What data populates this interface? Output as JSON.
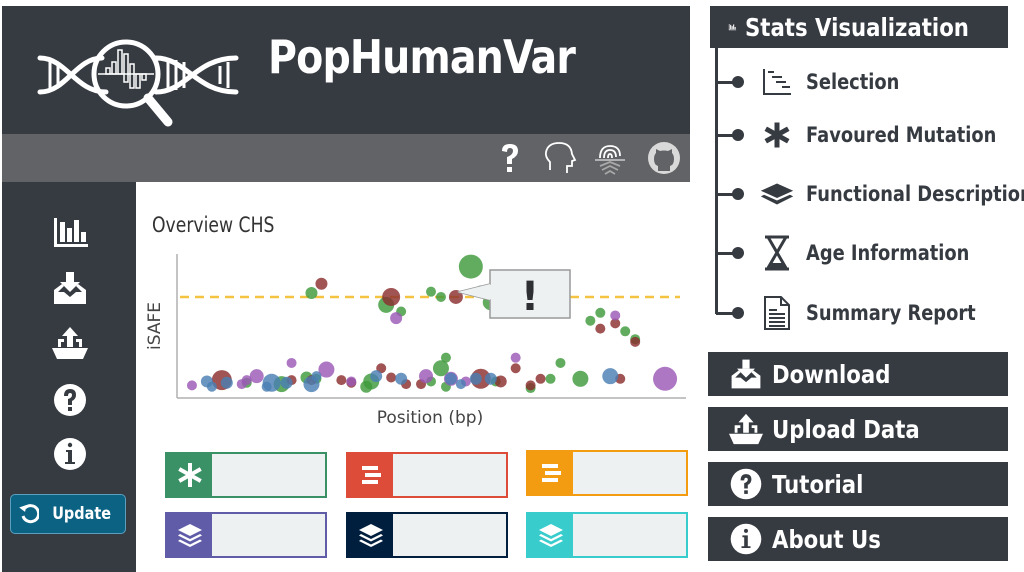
{
  "app": {
    "title": "PopHumanVar",
    "logo": "dna-magnifier-logo",
    "toolbar_icons": [
      "question-icon",
      "head-profile-icon",
      "fingerprint-icon",
      "github-icon"
    ],
    "sidebar_icons": [
      "bar-chart-icon",
      "download-inbox-icon",
      "upload-tray-icon",
      "question-circle-icon",
      "info-circle-icon"
    ],
    "update_button": "Update"
  },
  "chart_data": {
    "type": "scatter",
    "title": "Overview CHS",
    "xlabel": "Position (bp)",
    "ylabel": "iSAFE",
    "threshold_line": {
      "y": 0.72,
      "style": "dashed",
      "color": "#f5c342"
    },
    "xlim": [
      0,
      1
    ],
    "ylim": [
      0,
      1
    ],
    "grid": false,
    "annotation": {
      "text": "!",
      "target": "highlighted-point"
    },
    "series": [
      {
        "name": "green",
        "color": "#3f9a3c",
        "points": [
          {
            "x": 0.13,
            "y": 0.07,
            "r": 5
          },
          {
            "x": 0.25,
            "y": 0.11,
            "r": 6
          },
          {
            "x": 0.26,
            "y": 0.75,
            "r": 6
          },
          {
            "x": 0.2,
            "y": 0.06,
            "r": 8
          },
          {
            "x": 0.37,
            "y": 0.04,
            "r": 6
          },
          {
            "x": 0.38,
            "y": 0.08,
            "r": 8
          },
          {
            "x": 0.41,
            "y": 0.66,
            "r": 8
          },
          {
            "x": 0.44,
            "y": 0.61,
            "r": 5
          },
          {
            "x": 0.5,
            "y": 0.76,
            "r": 5
          },
          {
            "x": 0.52,
            "y": 0.72,
            "r": 5
          },
          {
            "x": 0.58,
            "y": 0.95,
            "r": 12
          },
          {
            "x": 0.6,
            "y": 0.77,
            "r": 5
          },
          {
            "x": 0.62,
            "y": 0.68,
            "r": 8
          },
          {
            "x": 0.53,
            "y": 0.26,
            "r": 5
          },
          {
            "x": 0.52,
            "y": 0.18,
            "r": 8
          },
          {
            "x": 0.5,
            "y": 0.08,
            "r": 5
          },
          {
            "x": 0.53,
            "y": 0.04,
            "r": 5
          },
          {
            "x": 0.63,
            "y": 0.08,
            "r": 5
          },
          {
            "x": 0.76,
            "y": 0.22,
            "r": 5
          },
          {
            "x": 0.74,
            "y": 0.1,
            "r": 5
          },
          {
            "x": 0.7,
            "y": 0.03,
            "r": 5
          },
          {
            "x": 0.8,
            "y": 0.1,
            "r": 8
          },
          {
            "x": 0.82,
            "y": 0.54,
            "r": 5
          },
          {
            "x": 0.84,
            "y": 0.6,
            "r": 5
          },
          {
            "x": 0.89,
            "y": 0.46,
            "r": 5
          },
          {
            "x": 0.91,
            "y": 0.4,
            "r": 5
          },
          {
            "x": 0.27,
            "y": 0.1,
            "r": 5
          }
        ]
      },
      {
        "name": "maroon",
        "color": "#8b2e2e",
        "points": [
          {
            "x": 0.08,
            "y": 0.09,
            "r": 10
          },
          {
            "x": 0.28,
            "y": 0.82,
            "r": 6
          },
          {
            "x": 0.22,
            "y": 0.09,
            "r": 5
          },
          {
            "x": 0.26,
            "y": 0.09,
            "r": 5
          },
          {
            "x": 0.34,
            "y": 0.07,
            "r": 5
          },
          {
            "x": 0.32,
            "y": 0.09,
            "r": 5
          },
          {
            "x": 0.4,
            "y": 0.18,
            "r": 5
          },
          {
            "x": 0.42,
            "y": 0.11,
            "r": 5
          },
          {
            "x": 0.42,
            "y": 0.72,
            "r": 9
          },
          {
            "x": 0.55,
            "y": 0.72,
            "r": 7
          },
          {
            "x": 0.45,
            "y": 0.06,
            "r": 5
          },
          {
            "x": 0.48,
            "y": 0.06,
            "r": 5
          },
          {
            "x": 0.6,
            "y": 0.1,
            "r": 10
          },
          {
            "x": 0.64,
            "y": 0.08,
            "r": 6
          },
          {
            "x": 0.67,
            "y": 0.18,
            "r": 5
          },
          {
            "x": 0.7,
            "y": 0.05,
            "r": 5
          },
          {
            "x": 0.84,
            "y": 0.48,
            "r": 5
          },
          {
            "x": 0.87,
            "y": 0.52,
            "r": 5
          },
          {
            "x": 0.91,
            "y": 0.38,
            "r": 5
          },
          {
            "x": 0.88,
            "y": 0.1,
            "r": 5
          },
          {
            "x": 0.72,
            "y": 0.1,
            "r": 5
          }
        ]
      },
      {
        "name": "purple",
        "color": "#9b59b6",
        "points": [
          {
            "x": 0.02,
            "y": 0.05,
            "r": 5
          },
          {
            "x": 0.15,
            "y": 0.12,
            "r": 7
          },
          {
            "x": 0.22,
            "y": 0.22,
            "r": 5
          },
          {
            "x": 0.29,
            "y": 0.17,
            "r": 8
          },
          {
            "x": 0.43,
            "y": 0.56,
            "r": 6
          },
          {
            "x": 0.34,
            "y": 0.08,
            "r": 5
          },
          {
            "x": 0.49,
            "y": 0.12,
            "r": 7
          },
          {
            "x": 0.54,
            "y": 0.1,
            "r": 7
          },
          {
            "x": 0.57,
            "y": 0.08,
            "r": 5
          },
          {
            "x": 0.67,
            "y": 0.26,
            "r": 5
          },
          {
            "x": 0.87,
            "y": 0.58,
            "r": 5
          },
          {
            "x": 0.97,
            "y": 0.1,
            "r": 12
          },
          {
            "x": 0.13,
            "y": 0.09,
            "r": 5
          },
          {
            "x": 0.12,
            "y": 0.06,
            "r": 5
          }
        ]
      },
      {
        "name": "blue",
        "color": "#4b7fb3",
        "points": [
          {
            "x": 0.05,
            "y": 0.08,
            "r": 6
          },
          {
            "x": 0.06,
            "y": 0.04,
            "r": 5
          },
          {
            "x": 0.09,
            "y": 0.07,
            "r": 6
          },
          {
            "x": 0.18,
            "y": 0.07,
            "r": 9
          },
          {
            "x": 0.21,
            "y": 0.07,
            "r": 6
          },
          {
            "x": 0.26,
            "y": 0.06,
            "r": 8
          },
          {
            "x": 0.27,
            "y": 0.12,
            "r": 5
          },
          {
            "x": 0.39,
            "y": 0.12,
            "r": 6
          },
          {
            "x": 0.44,
            "y": 0.1,
            "r": 6
          },
          {
            "x": 0.54,
            "y": 0.1,
            "r": 6
          },
          {
            "x": 0.56,
            "y": 0.06,
            "r": 5
          },
          {
            "x": 0.59,
            "y": 0.1,
            "r": 6
          },
          {
            "x": 0.62,
            "y": 0.1,
            "r": 6
          },
          {
            "x": 0.86,
            "y": 0.12,
            "r": 8
          },
          {
            "x": 0.17,
            "y": 0.04,
            "r": 5
          }
        ]
      }
    ]
  },
  "tiles": [
    {
      "icon": "asterisk-icon",
      "color": "#3a9166"
    },
    {
      "icon": "bars-icon",
      "color": "#dd4b39"
    },
    {
      "icon": "bars-icon",
      "color": "#f39c12"
    },
    {
      "icon": "layers-icon",
      "color": "#605ca8"
    },
    {
      "icon": "layers-icon",
      "color": "#001f3f"
    },
    {
      "icon": "layers-icon",
      "color": "#39cccc"
    }
  ],
  "menu": {
    "stats_header": "Stats Visualization",
    "sub_items": [
      {
        "label": "Selection",
        "icon": "selection-chart-icon"
      },
      {
        "label": "Favoured Mutation",
        "icon": "asterisk-icon"
      },
      {
        "label": "Functional Description",
        "icon": "layers-icon"
      },
      {
        "label": "Age Information",
        "icon": "hourglass-icon"
      },
      {
        "label": "Summary Report",
        "icon": "document-icon"
      }
    ],
    "buttons": [
      {
        "label": "Download",
        "icon": "download-inbox-icon"
      },
      {
        "label": "Upload Data",
        "icon": "upload-tray-icon"
      },
      {
        "label": "Tutorial",
        "icon": "question-circle-icon"
      },
      {
        "label": "About Us",
        "icon": "info-circle-icon"
      }
    ]
  }
}
